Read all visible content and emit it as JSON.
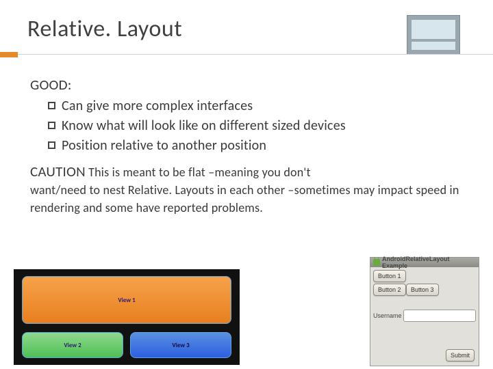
{
  "title": "Relative. Layout",
  "good_label": "GOOD:",
  "bullets": [
    "Can give more complex interfaces",
    "Know what will look like on different sized devices",
    "Position relative to another position"
  ],
  "caution_label": "CAUTION",
  "caution_text_first": " This is meant to be flat –meaning you don't ",
  "caution_text_rest": "want/need to nest Relative. Layouts in each other –sometimes may impact speed in rendering and some have reported problems.",
  "layout_preview": {
    "view1": "View 1",
    "view2": "View 2",
    "view3": "View 3"
  },
  "phone": {
    "title": "AndroidRelativeLayout",
    "subtitle": "Example",
    "button1": "Button 1",
    "button2": "Button 2",
    "button3": "Button 3",
    "username_label": "Username",
    "submit": "Submit"
  }
}
